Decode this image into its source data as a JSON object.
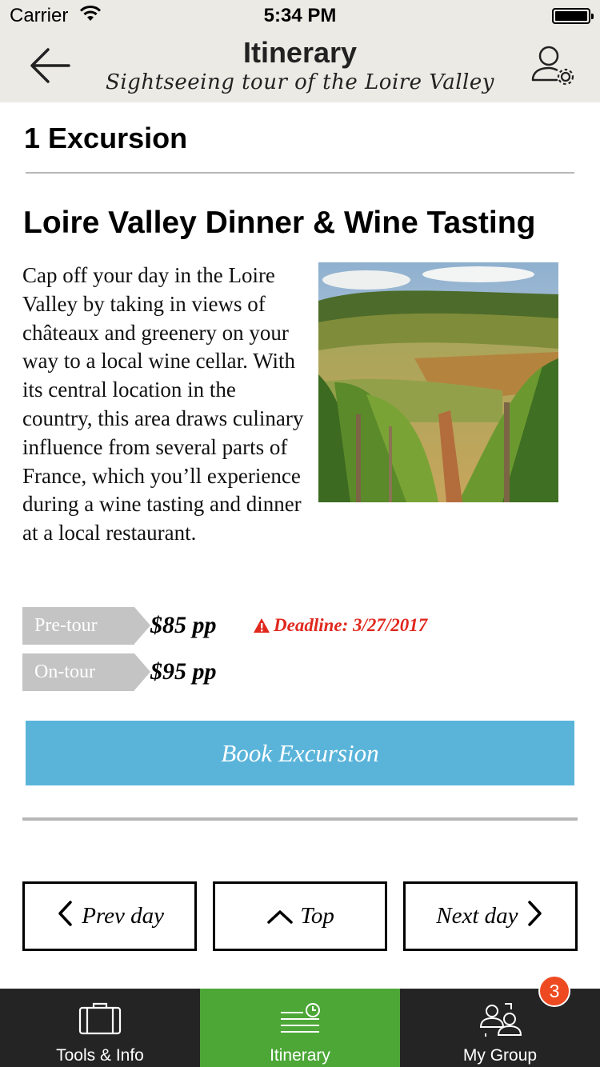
{
  "status_bar": {
    "carrier": "Carrier",
    "time": "5:34 PM"
  },
  "nav": {
    "title": "Itinerary",
    "subtitle": "Sightseeing tour of the Loire Valley",
    "back_icon": "back-arrow-icon",
    "profile_icon": "user-settings-icon"
  },
  "section": {
    "title": "1 Excursion"
  },
  "excursion": {
    "title": "Loire Valley Dinner & Wine Tasting",
    "description": "Cap off your day in the Loire Valley by taking in views of châteaux and greenery on your way to a local wine cellar. With its central location in the country, this area draws culinary influence from several parts of France, which you’ll experience during a wine tasting and dinner at a local restaurant.",
    "image_alt": "vineyard-photo",
    "pricing": [
      {
        "label": "Pre-tour",
        "price": "$85 pp"
      },
      {
        "label": "On-tour",
        "price": "$95 pp"
      }
    ],
    "deadline": "Deadline: 3/27/2017",
    "book_label": "Book Excursion"
  },
  "pager": {
    "prev_label": "Prev day",
    "top_label": "Top",
    "next_label": "Next day"
  },
  "tab_bar": {
    "tabs": [
      {
        "label": "Tools & Info",
        "icon": "briefcase-icon"
      },
      {
        "label": "Itinerary",
        "icon": "itinerary-icon",
        "active": true
      },
      {
        "label": "My Group",
        "icon": "group-icon"
      }
    ],
    "group_badge": "3"
  },
  "colors": {
    "header_bg": "#ebeae4",
    "accent_blue": "#5ab4da",
    "deadline_red": "#e0281d",
    "active_tab_green": "#4ca737",
    "tab_bar_bg": "#242424",
    "badge_orange": "#ee4a22",
    "tag_gray": "#c4c4c4"
  }
}
